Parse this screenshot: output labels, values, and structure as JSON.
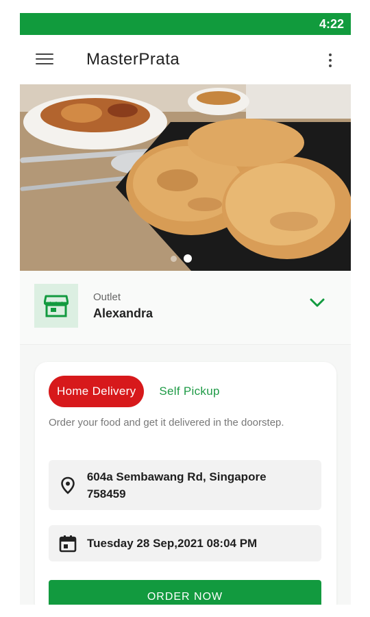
{
  "status_bar": {
    "time": "4:22"
  },
  "app_bar": {
    "title": "MasterPrata",
    "menu_icon": "hamburger-menu-icon",
    "more_icon": "more-vertical-icon"
  },
  "hero": {
    "slide_count": 2,
    "active_slide": 2
  },
  "outlet": {
    "label": "Outlet",
    "value": "Alexandra",
    "icon": "storefront-icon",
    "chevron_icon": "chevron-down-icon"
  },
  "order_card": {
    "tabs": {
      "delivery": "Home Delivery",
      "pickup": "Self Pickup",
      "active": "delivery"
    },
    "description": "Order your food and get it delivered in the doorstep.",
    "address": "604a Sembawang Rd, Singapore 758459",
    "datetime": "Tuesday 28 Sep,2021 08:04 PM",
    "order_button": "ORDER NOW"
  },
  "colors": {
    "primary_green": "#119b3d",
    "accent_red": "#d7191b",
    "icon_bg": "#dcefe2"
  }
}
